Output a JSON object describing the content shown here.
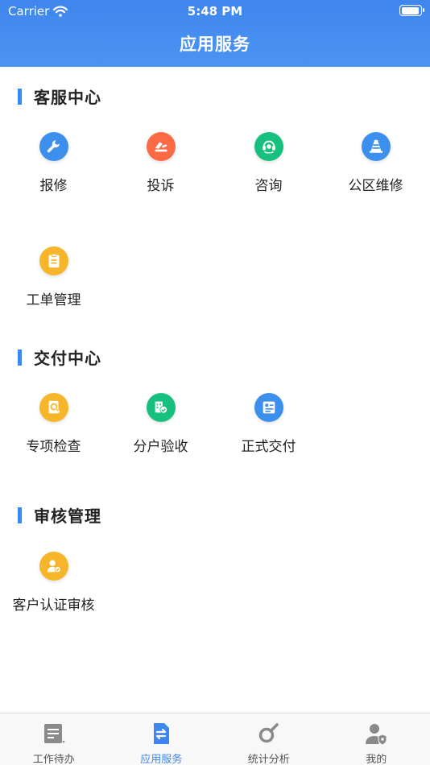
{
  "status_bar": {
    "carrier": "Carrier",
    "time": "5:48 PM",
    "battery_level": 0.95
  },
  "nav": {
    "title": "应用服务"
  },
  "colors": {
    "accent": "#3f86ee",
    "blue": "#3d8fee",
    "orange": "#fa6a45",
    "green": "#17c07f",
    "yellow": "#f7b52a"
  },
  "sections": [
    {
      "title": "客服中心",
      "items": [
        {
          "label": "报修",
          "icon": "wrench-icon",
          "color": "blue"
        },
        {
          "label": "投诉",
          "icon": "complaint-icon",
          "color": "orange"
        },
        {
          "label": "咨询",
          "icon": "headset-icon",
          "color": "green"
        },
        {
          "label": "公区维修",
          "icon": "traffic-cone-icon",
          "color": "blue"
        },
        {
          "label": "工单管理",
          "icon": "clipboard-icon",
          "color": "yellow"
        }
      ]
    },
    {
      "title": "交付中心",
      "items": [
        {
          "label": "专项检查",
          "icon": "search-document-icon",
          "color": "yellow"
        },
        {
          "label": "分户验收",
          "icon": "acceptance-icon",
          "color": "green"
        },
        {
          "label": "正式交付",
          "icon": "delivery-icon",
          "color": "blue"
        }
      ]
    },
    {
      "title": "审核管理",
      "items": [
        {
          "label": "客户认证审核",
          "icon": "user-verify-icon",
          "color": "yellow"
        }
      ]
    }
  ],
  "tabbar": {
    "active": 1,
    "tabs": [
      {
        "label": "工作待办",
        "icon": "todo-list-icon"
      },
      {
        "label": "应用服务",
        "icon": "app-service-icon"
      },
      {
        "label": "统计分析",
        "icon": "statistics-icon"
      },
      {
        "label": "我的",
        "icon": "profile-icon"
      }
    ]
  }
}
